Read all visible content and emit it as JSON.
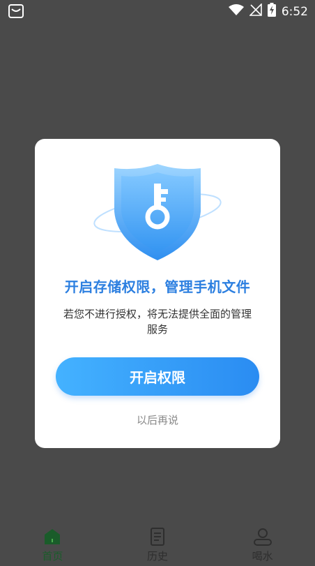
{
  "status_bar": {
    "time": "6:52"
  },
  "dialog": {
    "title": "开启存储权限，管理手机文件",
    "description": "若您不进行授权，将无法提供全面的管理服务",
    "primary_button": "开启权限",
    "later_link": "以后再说"
  },
  "bottom_nav": {
    "items": [
      {
        "label": "首页",
        "icon": "home-icon",
        "active": true
      },
      {
        "label": "历史",
        "icon": "document-icon",
        "active": false
      },
      {
        "label": "喝水",
        "icon": "user-icon",
        "active": false
      }
    ]
  },
  "colors": {
    "accent": "#2c7fe0",
    "button_start": "#44b2ff",
    "button_end": "#2a8cf2",
    "overlay": "#4a4a4a",
    "nav_active": "#1a5c2a"
  }
}
